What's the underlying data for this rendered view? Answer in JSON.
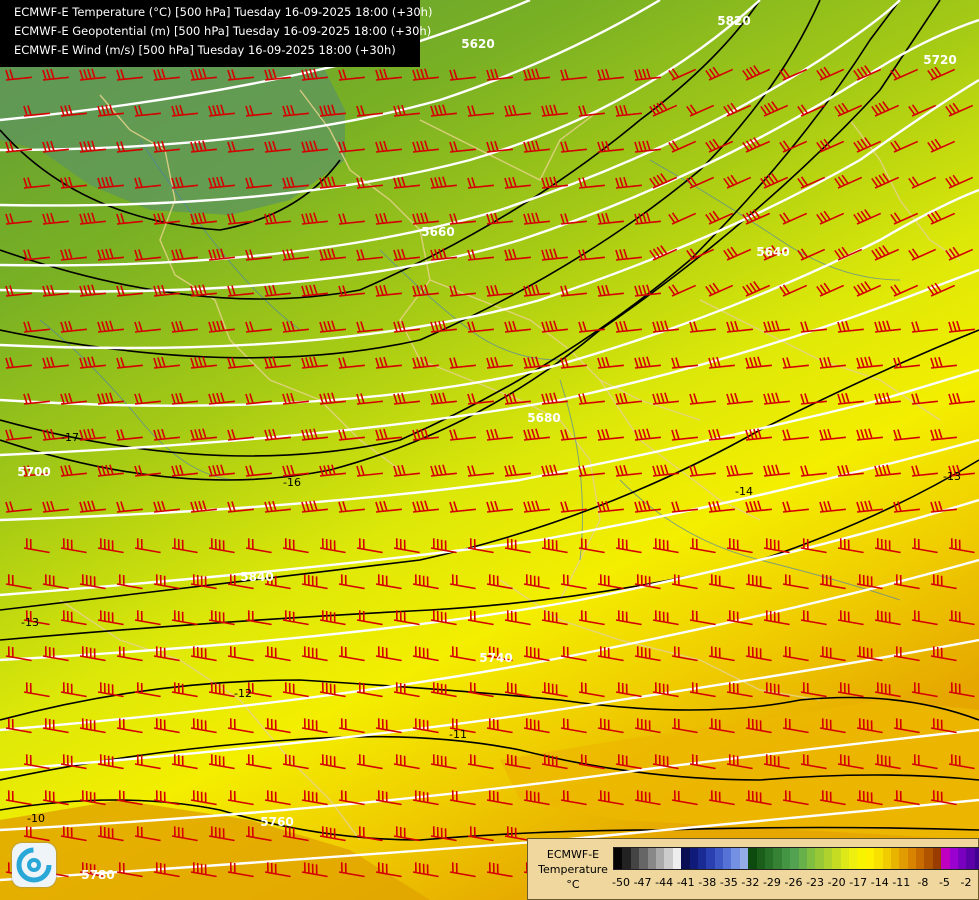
{
  "header": {
    "lines": [
      "ECMWF-E Temperature (°C) [500 hPa] Tuesday 16-09-2025 18:00 (+30h)",
      "ECMWF-E Geopotential (m) [500 hPa] Tuesday 16-09-2025 18:00 (+30h)",
      "ECMWF-E Wind (m/s) [500 hPa] Tuesday 16-09-2025 18:00 (+30h)"
    ]
  },
  "geopotential_labels": [
    "5620",
    "5640",
    "5660",
    "5680",
    "5700",
    "5720",
    "5740",
    "5760",
    "5780",
    "5820",
    "5840"
  ],
  "temperature_labels": [
    "-17",
    "-16",
    "-14",
    "-13",
    "-13",
    "-12",
    "-11",
    "-10"
  ],
  "colors": {
    "geopotential_line": "#ffffff",
    "isotherm_line": "#000000",
    "wind_barb": "#d40000",
    "border": "#e6d28a",
    "river": "#4a80b0"
  },
  "legend": {
    "model": "ECMWF-E",
    "field": "Temperature",
    "unit": "°C",
    "ticks": [
      "-50",
      "-47",
      "-44",
      "-41",
      "-38",
      "-35",
      "-32",
      "-29",
      "-26",
      "-23",
      "-20",
      "-17",
      "-14",
      "-11",
      "-8",
      "-5",
      "-2"
    ],
    "swatches": [
      "#050505",
      "#222222",
      "#444444",
      "#666666",
      "#888888",
      "#aaaaaa",
      "#cccccc",
      "#eeeeee",
      "#0a0f55",
      "#101a78",
      "#1a2a95",
      "#2a40b0",
      "#3e58c6",
      "#5672d6",
      "#7490e2",
      "#94ace8",
      "#0d4a0d",
      "#1a5e1a",
      "#277027",
      "#358235",
      "#439443",
      "#52a252",
      "#68b04a",
      "#80be40",
      "#98c836",
      "#b0d22c",
      "#c6dc22",
      "#dce818",
      "#eef010",
      "#f8f400",
      "#fff000",
      "#f8e000",
      "#f0cc00",
      "#e8b400",
      "#e09c00",
      "#d88400",
      "#c86c00",
      "#b05400",
      "#983c00",
      "#c000c0",
      "#9a00d0",
      "#7a00c0",
      "#5c00a8",
      "#400090"
    ]
  }
}
